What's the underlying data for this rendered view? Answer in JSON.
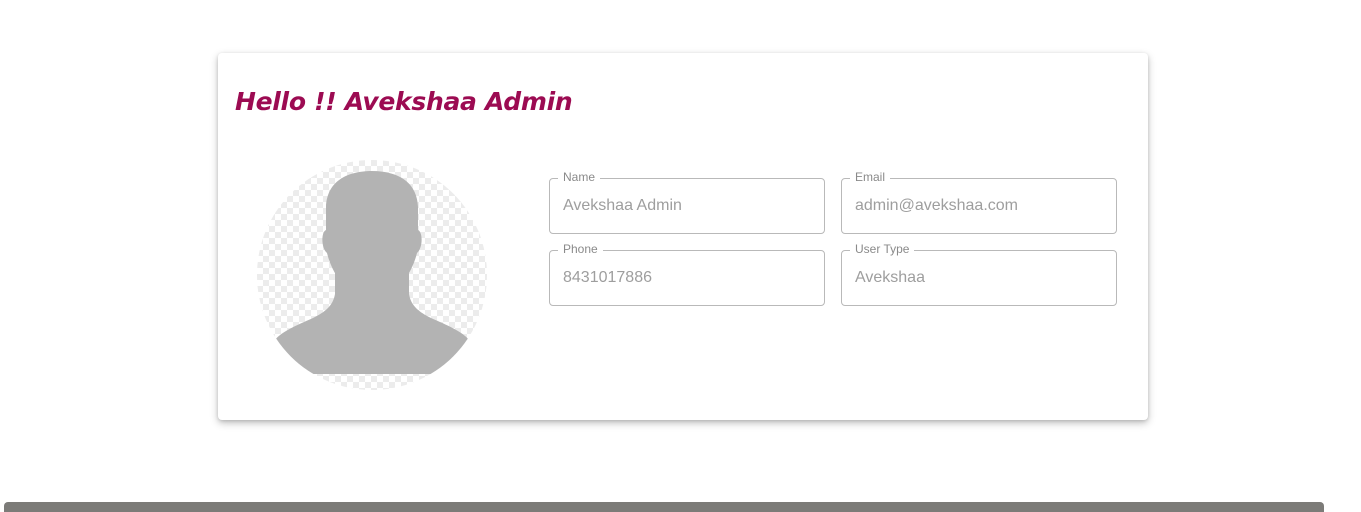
{
  "profile": {
    "greeting": "Hello !! Avekshaa Admin",
    "avatar_icon": "default-user-silhouette-icon",
    "fields": {
      "name": {
        "label": "Name",
        "value": "Avekshaa Admin"
      },
      "email": {
        "label": "Email",
        "value": "admin@avekshaa.com"
      },
      "phone": {
        "label": "Phone",
        "value": "8431017886"
      },
      "user_type": {
        "label": "User Type",
        "value": "Avekshaa"
      }
    }
  },
  "colors": {
    "greeting": "#9c0b52",
    "silhouette": "#b3b3b3",
    "field_border": "#b9b9b9",
    "field_text": "#9e9e9e",
    "bottom_bar": "#7c7b78"
  }
}
